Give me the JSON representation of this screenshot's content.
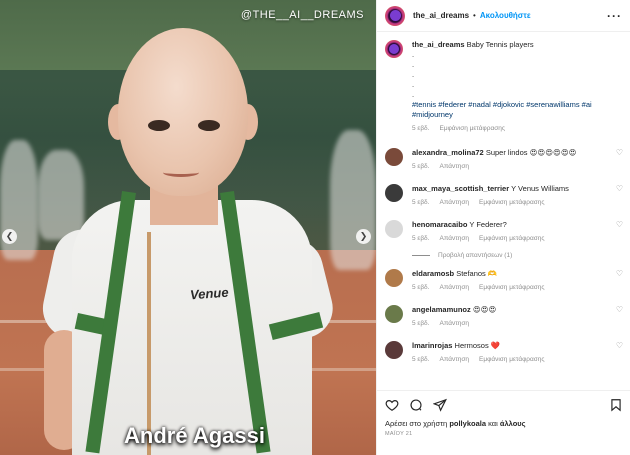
{
  "photo": {
    "watermark": "@THE__AI__DREAMS",
    "caption": "André Agassi",
    "shirt_logo": "Venue"
  },
  "header": {
    "username": "the_ai_dreams",
    "separator": "•",
    "follow_label": "Ακολουθήστε",
    "more_label": "···"
  },
  "post": {
    "username": "the_ai_dreams",
    "text": "Baby Tennis players",
    "dots": [
      ".",
      ".",
      ".",
      ".",
      "."
    ],
    "hashtags": "#tennis #federer #nadal #djokovic #serenawilliams #ai #midjourney",
    "time": "5 εβδ.",
    "see_translation": "Εμφάνιση μετάφρασης"
  },
  "comments": [
    {
      "username": "alexandra_molina72",
      "text": "Super lindos 😍😍😍😍😍😍",
      "time": "5 εβδ.",
      "action": "Απάντηση",
      "translate": "",
      "avatar_color": "#7a4a3a"
    },
    {
      "username": "max_maya_scottish_terrier",
      "text": "Y Venus Williams",
      "time": "5 εβδ.",
      "action": "Απάντηση",
      "translate": "Εμφάνιση μετάφρασης",
      "avatar_color": "#3a3a3a"
    },
    {
      "username": "henomaracaibo",
      "text": "Y Federer?",
      "time": "5 εβδ.",
      "action": "Απάντηση",
      "translate": "Εμφάνιση μετάφρασης",
      "avatar_color": "#d9d9d9"
    },
    {
      "username": "eldaramosb",
      "text": "Stefanos 🫶",
      "time": "5 εβδ.",
      "action": "Απάντηση",
      "translate": "Εμφάνιση μετάφρασης",
      "avatar_color": "#b07a4a"
    },
    {
      "username": "angelamamunoz",
      "text": "😍😍😍",
      "time": "5 εβδ.",
      "action": "Απάντηση",
      "translate": "",
      "avatar_color": "#6a7a4a"
    },
    {
      "username": "lmarinrojas",
      "text": "Hermosos ❤️",
      "time": "5 εβδ.",
      "action": "Απάντηση",
      "translate": "Εμφάνιση μετάφρασης",
      "avatar_color": "#5a3a3a"
    }
  ],
  "view_replies": "Προβολή απαντήσεων (1)",
  "likes": {
    "prefix": "Αρέσει στο χρήστη",
    "user": "pollykoala",
    "suffix": "και",
    "others": "άλλους"
  },
  "date": "ΜΑΪΟΥ 21",
  "icons": {
    "like": "heart-icon",
    "comment": "comment-icon",
    "share": "share-icon",
    "save": "bookmark-icon",
    "prev": "chevron-left-icon",
    "next": "chevron-right-icon"
  },
  "colors": {
    "link_blue": "#0095f6",
    "hashtag_blue": "#00376b",
    "secondary": "#8e8e8e",
    "heart_red": "#ed4956"
  }
}
